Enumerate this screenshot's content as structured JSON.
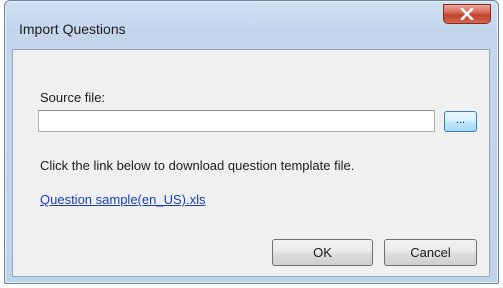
{
  "window": {
    "title": "Import Questions"
  },
  "form": {
    "source_label": "Source file:",
    "source_value": "",
    "browse_label": "...",
    "hint": "Click the link below to download question template file.",
    "template_link": "Question sample(en_US).xls"
  },
  "buttons": {
    "ok": "OK",
    "cancel": "Cancel"
  },
  "colors": {
    "close_button": "#c94a33",
    "link": "#1a3fb3",
    "titlebar": "#c3d6ec"
  },
  "icons": {
    "close": "close-icon"
  }
}
